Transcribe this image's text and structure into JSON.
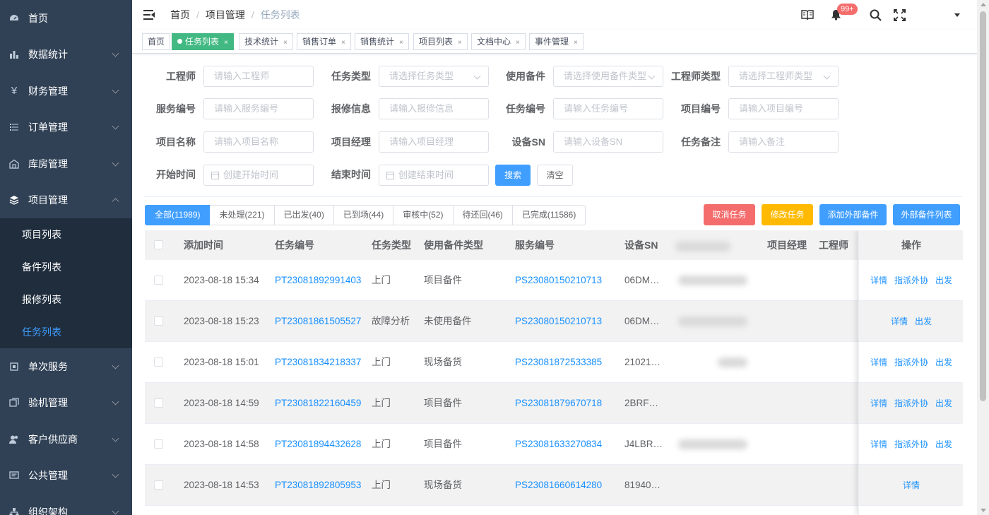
{
  "sidebar": {
    "menus": [
      {
        "label": "首页",
        "icon": "dashboard-icon"
      },
      {
        "label": "数据统计",
        "icon": "bar-chart-icon"
      },
      {
        "label": "财务管理",
        "icon": "yen-icon"
      },
      {
        "label": "订单管理",
        "icon": "list-icon"
      },
      {
        "label": "库房管理",
        "icon": "warehouse-icon"
      },
      {
        "label": "项目管理",
        "icon": "layers-icon"
      }
    ],
    "submenu": [
      "项目列表",
      "备件列表",
      "报修列表",
      "任务列表"
    ],
    "menus_after": [
      {
        "label": "单次服务",
        "icon": "service-icon"
      },
      {
        "label": "验机管理",
        "icon": "inspect-icon"
      },
      {
        "label": "客户供应商",
        "icon": "users-icon"
      },
      {
        "label": "公共管理",
        "icon": "public-icon"
      },
      {
        "label": "组织架构",
        "icon": "org-icon"
      }
    ]
  },
  "breadcrumb": [
    "首页",
    "项目管理",
    "任务列表"
  ],
  "navbar": {
    "badge": "99+"
  },
  "tags": [
    "首页",
    "任务列表",
    "技术统计",
    "销售订单",
    "销售统计",
    "项目列表",
    "文档中心",
    "事件管理"
  ],
  "filters": {
    "engineer": {
      "label": "工程师",
      "placeholder": "请输入工程师"
    },
    "task_type": {
      "label": "任务类型",
      "placeholder": "请选择任务类型"
    },
    "parts_used": {
      "label": "使用备件",
      "placeholder": "请选择使用备件类型"
    },
    "engineer_type": {
      "label": "工程师类型",
      "placeholder": "请选择工程师类型"
    },
    "service_no": {
      "label": "服务编号",
      "placeholder": "请输入服务编号"
    },
    "repair_info": {
      "label": "报修信息",
      "placeholder": "请输入报修信息"
    },
    "task_no": {
      "label": "任务编号",
      "placeholder": "请输入任务编号"
    },
    "project_no": {
      "label": "项目编号",
      "placeholder": "请输入项目编号"
    },
    "project_name": {
      "label": "项目名称",
      "placeholder": "请输入项目名称"
    },
    "project_manager": {
      "label": "项目经理",
      "placeholder": "请输入项目经理"
    },
    "device_sn": {
      "label": "设备SN",
      "placeholder": "请输入设备SN"
    },
    "task_remark": {
      "label": "任务备注",
      "placeholder": "请输入备注"
    },
    "start_time": {
      "label": "开始时间",
      "placeholder": "创建开始时间"
    },
    "end_time": {
      "label": "结束时间",
      "placeholder": "创建结束时间"
    },
    "search_btn": "搜索",
    "clear_btn": "清空"
  },
  "status_tabs": [
    "全部(11989)",
    "未处理(221)",
    "已出发(40)",
    "已到场(44)",
    "审核中(52)",
    "待还回(46)",
    "已完成(11586)"
  ],
  "actions": {
    "cancel": "取消任务",
    "modify": "修改任务",
    "add_external": "添加外部备件",
    "external_list": "外部备件列表"
  },
  "table": {
    "columns": [
      "添加时间",
      "任务编号",
      "任务类型",
      "使用备件类型",
      "服务编号",
      "设备SN",
      "项目经理",
      "工程师",
      "操作"
    ],
    "rows": [
      {
        "time": "2023-08-18 15:34",
        "task_no": "PT23081892991403",
        "type": "上门",
        "parts": "项目备件",
        "service_no": "PS23080150210713",
        "sn": "06DM…",
        "ops": [
          "详情",
          "指派外协",
          "出发"
        ]
      },
      {
        "time": "2023-08-18 15:23",
        "task_no": "PT23081861505527",
        "type": "故障分析",
        "parts": "未使用备件",
        "service_no": "PS23080150210713",
        "sn": "06DM…",
        "ops": [
          "详情",
          "出发"
        ]
      },
      {
        "time": "2023-08-18 15:01",
        "task_no": "PT23081834218337",
        "type": "上门",
        "parts": "现场备货",
        "service_no": "PS23081872533385",
        "sn": "21021…",
        "ops": [
          "详情",
          "指派外协",
          "出发"
        ]
      },
      {
        "time": "2023-08-18 14:59",
        "task_no": "PT23081822160459",
        "type": "上门",
        "parts": "项目备件",
        "service_no": "PS23081879670718",
        "sn": "2BRF…",
        "ops": [
          "详情",
          "指派外协",
          "出发"
        ]
      },
      {
        "time": "2023-08-18 14:58",
        "task_no": "PT23081894432628",
        "type": "上门",
        "parts": "项目备件",
        "service_no": "PS23081633270834",
        "sn": "J4LBR…",
        "ops": [
          "详情",
          "指派外协",
          "出发"
        ]
      },
      {
        "time": "2023-08-18 14:53",
        "task_no": "PT23081892805953",
        "type": "上门",
        "parts": "现场备货",
        "service_no": "PS23081660614280",
        "sn": "81940…",
        "ops": [
          "详情"
        ]
      }
    ]
  }
}
